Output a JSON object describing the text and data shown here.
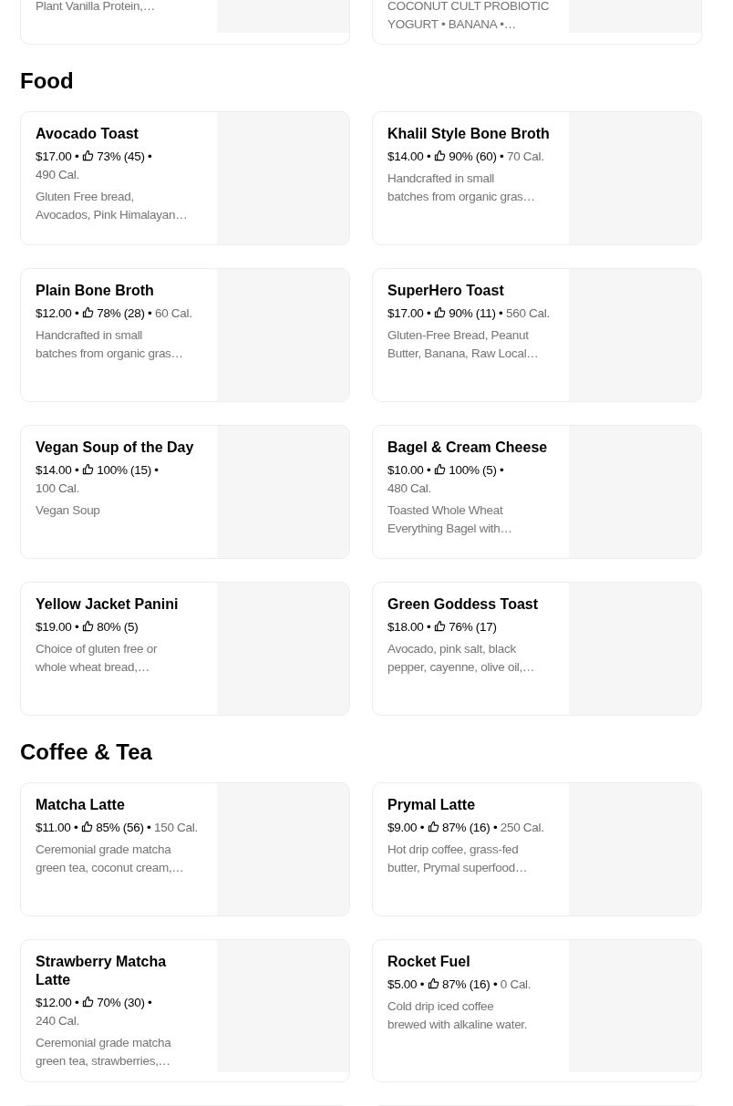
{
  "top_partial_cards": [
    {
      "description": "Plant Vanilla Protein,…"
    },
    {
      "description": "COCONUT CULT PROBIOTIC\nYOGURT • BANANA •…"
    }
  ],
  "sections": [
    {
      "title": "Food",
      "items": [
        {
          "kind": "item",
          "name": "Avocado Toast",
          "price": "$17.00 •",
          "rating": "73% (45) •\n",
          "calories": "490 Cal.",
          "description": "Gluten Free bread,\nAvocados, Pink Himalayan…"
        },
        {
          "kind": "item",
          "name": "Khalil Style Bone Broth",
          "price": "$14.00 •",
          "rating": "90% (60) •",
          "calories": "70 Cal.",
          "description": "Handcrafted in small\nbatches from organic gras…"
        },
        {
          "kind": "item",
          "name": "Plain Bone Broth",
          "price": "$12.00 •",
          "rating": "78% (28) •",
          "calories": "60 Cal.",
          "description": "Handcrafted in small\nbatches from organic gras…"
        },
        {
          "kind": "item",
          "name": "SuperHero Toast",
          "price": "$17.00 •",
          "rating": "90% (11) •",
          "calories": "560 Cal.",
          "description": "Gluten-Free Bread, Peanut\nButter, Banana, Raw Local…"
        },
        {
          "kind": "item",
          "name": "Vegan Soup of the Day",
          "price": "$14.00 •",
          "rating": "100% (15) •\n",
          "calories": "100 Cal.",
          "description": "Vegan Soup"
        },
        {
          "kind": "item",
          "name": "Bagel & Cream Cheese",
          "price": "$10.00 •",
          "rating": "100% (5) •\n",
          "calories": "480 Cal.",
          "description": "Toasted Whole Wheat\nEverything Bagel with…"
        },
        {
          "kind": "item",
          "name": "Yellow Jacket Panini",
          "price": "$19.00 •",
          "rating": "80% (5)",
          "description": "Choice of gluten free or\nwhole wheat bread,…"
        },
        {
          "kind": "item",
          "name": "Green Goddess Toast",
          "price": "$18.00 •",
          "rating": "76% (17)",
          "description": "Avocado, pink salt, black\npepper, cayenne, olive oil,…"
        }
      ]
    },
    {
      "title": "Coffee & Tea",
      "items": [
        {
          "kind": "item",
          "name": "Matcha Latte",
          "price": "$11.00 •",
          "rating": "85% (56) •",
          "calories": "150 Cal.",
          "description": "Ceremonial grade matcha\ngreen tea, coconut cream,…"
        },
        {
          "kind": "item",
          "name": "Prymal Latte",
          "price": "$9.00 •",
          "rating": "87% (16) •",
          "calories": "250 Cal.",
          "description": "Hot drip coffee, grass-fed\nbutter, Prymal superfood…"
        },
        {
          "kind": "item",
          "name": "Strawberry Matcha\nLatte",
          "price": "$12.00 •",
          "rating": "70% (30) •\n",
          "calories": "240 Cal.",
          "description": "Ceremonial grade matcha\ngreen tea, strawberries,…"
        },
        {
          "kind": "item",
          "name": "Rocket Fuel",
          "price": "$5.00 •",
          "rating": "87% (16) •",
          "calories": "0 Cal.",
          "description": "Cold drip iced coffee\nbrewed with alkaline water."
        },
        {
          "kind": "cut_off"
        },
        {
          "kind": "cut_off"
        }
      ]
    }
  ]
}
